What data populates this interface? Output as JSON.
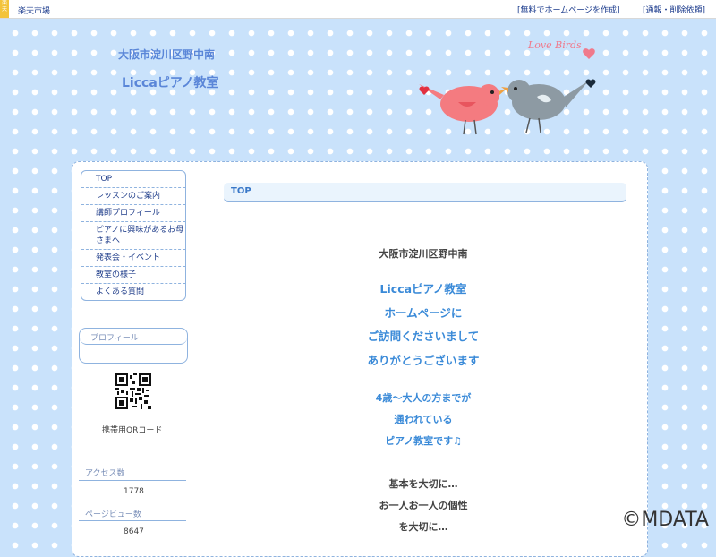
{
  "topbar": {
    "badge": "楽天",
    "brand": "楽天市場",
    "create_link": "[無料でホームページを作成]",
    "report_link": "[通報・削除依頼]"
  },
  "header": {
    "location": "大阪市淀川区野中南",
    "title": "Liccaピアノ教室",
    "decoration_text": "Love Birds"
  },
  "menu": {
    "items": [
      {
        "label": "TOP"
      },
      {
        "label": "レッスンのご案内"
      },
      {
        "label": "講師プロフィール"
      },
      {
        "label": "ピアノに興味があるお母さまへ"
      },
      {
        "label": "発表会・イベント"
      },
      {
        "label": "教室の様子"
      },
      {
        "label": "よくある質問"
      }
    ]
  },
  "sidebar": {
    "profile_heading": "プロフィール",
    "qr_label": "携帯用QRコード",
    "access_label": "アクセス数",
    "access_value": "1778",
    "pageview_label": "ページビュー数",
    "pageview_value": "8647"
  },
  "main": {
    "section_title": "TOP",
    "lines": [
      "大阪市淀川区野中南",
      "Liccaピアノ教室",
      "ホームページに",
      "ご訪問くださいまして",
      "ありがとうございます",
      "4歳～大人の方までが",
      "通われている",
      "ピアノ教室です♫",
      "基本を大切に…",
      "お一人お一人の個性",
      "を大切に…"
    ]
  },
  "watermark": "©MDATA",
  "colors": {
    "background": "#c9e2fb",
    "accent": "#3a8ad8",
    "border": "#8fb3df",
    "link": "#1a3a8c"
  }
}
